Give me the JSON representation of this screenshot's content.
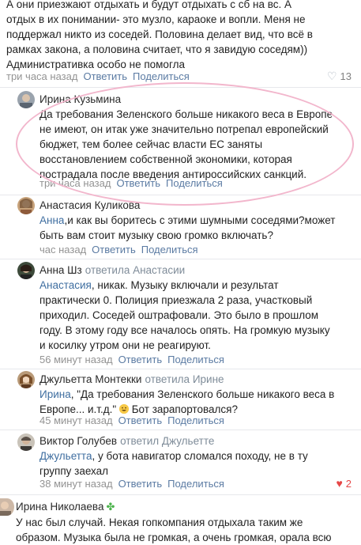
{
  "top_comment": {
    "lines": [
      "А они приезжают отдыхать и будут отдыхать с сб на вс. А",
      "отдых в их понимании- это музло, караоке и вопли. Меня не",
      "поддержал никто из соседей. Половина делает вид, что всё в",
      "рамках закона, а половина считает, что я завидую соседям))",
      "Административка особо не помогла"
    ],
    "time": "три часа назад",
    "reply": "Ответить",
    "share": "Поделиться",
    "likes": "13"
  },
  "comments": [
    {
      "name": "Ирина Кузьмина",
      "replied_to": "",
      "mention": "",
      "lines": [
        "Да требования Зеленского больше никакого веса в Европе",
        "не имеют, он итак уже значительно потрепал европейский",
        "бюджет, тем более сейчас власти ЕС заняты",
        "восстановлением собственной экономики, которая",
        "пострадала после введения антироссийских санкций."
      ],
      "time": "три часа назад",
      "reply": "Ответить",
      "share": "Поделиться"
    },
    {
      "name": "Анастасия Куликова",
      "replied_to": "",
      "mention": "Анна",
      "lines": [
        ",и как вы боритесь с этими шумными соседями?может",
        "быть вам стоит музыку свою громко включать?"
      ],
      "time": "час назад",
      "reply": "Ответить",
      "share": "Поделиться"
    },
    {
      "name": "Анна Шз",
      "replied_to": "ответила Анастасии",
      "mention": "Анастасия",
      "lines": [
        ", никак. Музыку включали и результат",
        "практически 0. Полиция приезжала 2 раза, участковый",
        "приходил. Соседей оштрафовали. Это было в прошлом",
        "году. В этому году все началось опять. На громкую музыку",
        "и косилку утром они не реагируют."
      ],
      "time": "56 минут назад",
      "reply": "Ответить",
      "share": "Поделиться"
    },
    {
      "name": "Джульетта Монтекки",
      "replied_to": "ответила Ирине",
      "mention": "Ирина",
      "lines": [
        ", \"Да требования Зеленского больше никакого веса в",
        "Европе... и.т.д.\"",
        " Бот зарапортовался?"
      ],
      "time": "45 минут назад",
      "reply": "Ответить",
      "share": "Поделиться"
    },
    {
      "name": "Виктор Голубев",
      "replied_to": "ответил Джульетте",
      "mention": "Джульетта",
      "lines": [
        ", у бота навигатор сломался походу, не в ту",
        "группу заехал"
      ],
      "time": "38 минут назад",
      "reply": "Ответить",
      "share": "Поделиться",
      "likes": "2"
    },
    {
      "name": "Ирина Николаева",
      "replied_to": "",
      "mention": "",
      "lines": [
        "У нас был случай. Некая гопкомпания отдыхала таким же",
        "образом. Музыка была не громкая, а очень громкая, орала всю"
      ]
    }
  ],
  "colors": {
    "link": "#3f6ea0",
    "action": "#5b7ba3",
    "meta": "#828282",
    "highlight_oval": "#f2b6cc",
    "liked_heart": "#e64646"
  },
  "icons": [
    "heart-icon",
    "clover-icon",
    "grin-emoji-icon"
  ]
}
